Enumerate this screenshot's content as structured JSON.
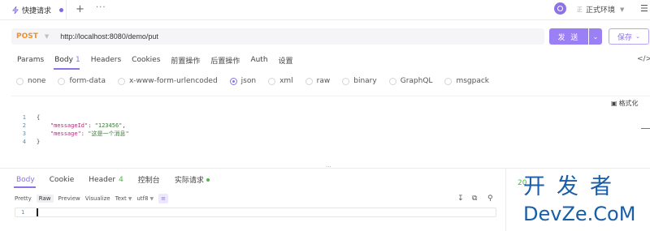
{
  "tab": {
    "icon": "lightning-icon",
    "title": "快捷请求",
    "add": "+",
    "more": "···"
  },
  "env": {
    "icon": "environment-icon",
    "badge": "正",
    "label": "正式环境"
  },
  "request": {
    "method": "POST",
    "url": "http://localhost:8080/demo/put",
    "send": "发 送",
    "save": "保存"
  },
  "req_tabs": [
    {
      "label": "Params"
    },
    {
      "label": "Body",
      "count": "1"
    },
    {
      "label": "Headers"
    },
    {
      "label": "Cookies"
    },
    {
      "label": "前置操作"
    },
    {
      "label": "后置操作"
    },
    {
      "label": "Auth"
    },
    {
      "label": "设置"
    }
  ],
  "code_toggle": "</>",
  "body_types": [
    "none",
    "form-data",
    "x-www-form-urlencoded",
    "json",
    "xml",
    "raw",
    "binary",
    "GraphQL",
    "msgpack"
  ],
  "body_selected": "json",
  "format_label": "格式化",
  "code_lines": {
    "l1": {
      "n": "1",
      "t": "{"
    },
    "l2": {
      "n": "2",
      "k": "\"messageId\"",
      "sep": ": ",
      "v": "\"123456\"",
      "end": ","
    },
    "l3": {
      "n": "3",
      "k": "\"message\"",
      "sep": ": ",
      "v": "\"这是一个消息\"",
      "end": ""
    },
    "l4": {
      "n": "4",
      "t": "}"
    }
  },
  "resize_handle": "···",
  "resp_tabs": {
    "body": "Body",
    "cookie": "Cookie",
    "header": "Header",
    "header_count": "4",
    "console": "控制台",
    "actual": "实际请求"
  },
  "status_partial": "20",
  "fmt": {
    "pretty": "Pretty",
    "raw": "Raw",
    "preview": "Preview",
    "visualize": "Visualize",
    "text": "Text",
    "encoding": "utf8"
  },
  "resp_line": "1",
  "watermark": {
    "line1": "开发者",
    "line2": "DevZe.CoM"
  },
  "colors": {
    "accent": "#8d73e6",
    "method": "#f0912a",
    "success": "#52b34c",
    "watermark": "#1a5ea8"
  }
}
